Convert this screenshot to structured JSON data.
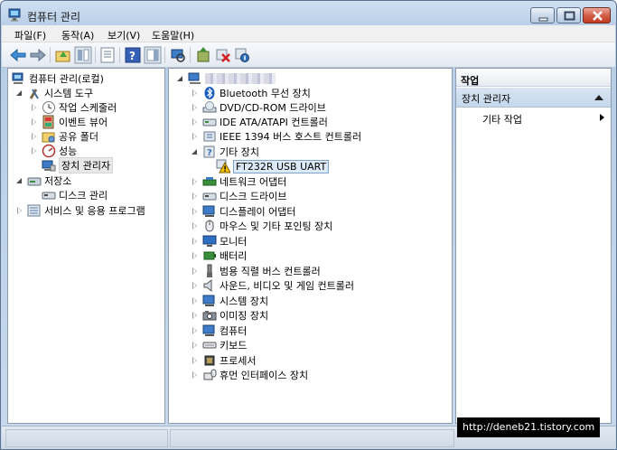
{
  "window": {
    "title": "컴퓨터 관리"
  },
  "menu": {
    "items": [
      "파일(F)",
      "동작(A)",
      "보기(V)",
      "도움말(H)"
    ]
  },
  "toolbar": {
    "buttons": [
      "back-arrow-icon",
      "forward-arrow-icon",
      "up-folder-icon",
      "console-tree-icon",
      "properties-icon",
      "help-icon",
      "show-hide-icon",
      "scan-hardware-icon",
      "update-driver-icon",
      "uninstall-icon",
      "disable-icon"
    ]
  },
  "left_tree": {
    "root": "컴퓨터 관리(로컬)",
    "system_tools": "시스템 도구",
    "task_scheduler": "작업 스케줄러",
    "event_viewer": "이벤트 뷰어",
    "shared_folders": "공유 폴더",
    "performance": "성능",
    "device_manager": "장치 관리자",
    "storage": "저장소",
    "disk_management": "디스크 관리",
    "services_apps": "서비스 및 응용 프로그램"
  },
  "device_tree": {
    "categories": [
      "Bluetooth 무선 장치",
      "DVD/CD-ROM 드라이브",
      "IDE ATA/ATAPI 컨트롤러",
      "IEEE 1394 버스 호스트 컨트롤러",
      "기타 장치",
      "FT232R USB UART",
      "네트워크 어댑터",
      "디스크 드라이브",
      "디스플레이 어댑터",
      "마우스 및 기타 포인팅 장치",
      "모니터",
      "배터리",
      "범용 직렬 버스 컨트롤러",
      "사운드, 비디오 및 게임 컨트롤러",
      "시스템 장치",
      "이미징 장치",
      "컴퓨터",
      "키보드",
      "프로세서",
      "휴먼 인터페이스 장치"
    ]
  },
  "actions": {
    "header": "작업",
    "section": "장치 관리자",
    "item": "기타 작업"
  },
  "watermark": "http://deneb21.tistory.com",
  "colors": {
    "accent": "#3a78c3",
    "warning": "#f2c200"
  }
}
